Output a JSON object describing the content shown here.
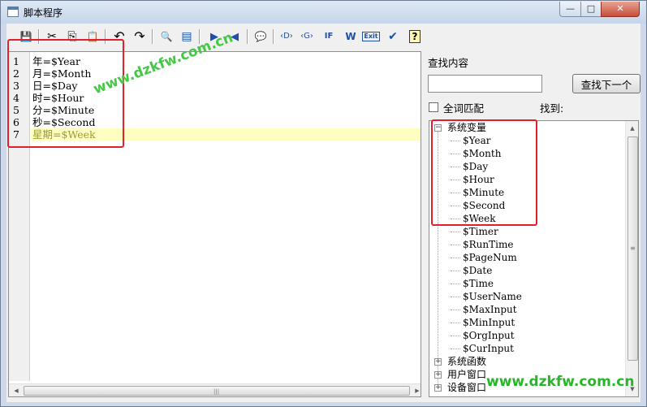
{
  "window": {
    "title": "脚本程序",
    "controls": {
      "minimize": "—",
      "maximize": "□",
      "close": "✕"
    }
  },
  "toolbar": {
    "icons": [
      {
        "name": "save-icon",
        "glyph": "💾"
      },
      {
        "name": "cut-icon",
        "glyph": "✂"
      },
      {
        "name": "copy-icon",
        "glyph": "⎘"
      },
      {
        "name": "paste-icon",
        "glyph": "📋"
      },
      {
        "name": "undo-icon",
        "glyph": "↶"
      },
      {
        "name": "redo-icon",
        "glyph": "↷"
      },
      {
        "name": "find-icon",
        "glyph": "🔍"
      },
      {
        "name": "replace-icon",
        "glyph": "▤"
      },
      {
        "name": "indent-icon",
        "glyph": "▶"
      },
      {
        "name": "outdent-icon",
        "glyph": "◀"
      },
      {
        "name": "comment-icon",
        "glyph": "💬"
      },
      {
        "name": "d-tag-icon",
        "glyph": "‹D›"
      },
      {
        "name": "g-tag-icon",
        "glyph": "‹G›"
      },
      {
        "name": "if-else-icon",
        "glyph": "IF"
      },
      {
        "name": "while-icon",
        "glyph": "W"
      },
      {
        "name": "exit-icon",
        "glyph": "Exit"
      },
      {
        "name": "check-icon",
        "glyph": "✔"
      },
      {
        "name": "help-icon",
        "glyph": "?"
      }
    ]
  },
  "editor": {
    "line_numbers": [
      "1",
      "2",
      "3",
      "4",
      "5",
      "6",
      "7"
    ],
    "lines": [
      "年=$Year",
      "月=$Month",
      "日=$Day",
      "时=$Hour",
      "分=$Minute",
      "秒=$Second",
      "星期=$Week"
    ],
    "current_line": 7
  },
  "find_panel": {
    "label": "查找内容",
    "input_value": "",
    "find_next_button": "查找下一个",
    "whole_word_label": "全词匹配",
    "whole_word_checked": false,
    "found_label": "找到:"
  },
  "tree": {
    "system_variables": {
      "label": "系统变量",
      "toggle": "−",
      "items": [
        "$Year",
        "$Month",
        "$Day",
        "$Hour",
        "$Minute",
        "$Second",
        "$Week",
        "$Timer",
        "$RunTime",
        "$PageNum",
        "$Date",
        "$Time",
        "$UserName",
        "$MaxInput",
        "$MinInput",
        "$OrgInput",
        "$CurInput"
      ]
    },
    "collapsed": [
      {
        "label": "系统函数",
        "toggle": "+"
      },
      {
        "label": "用户窗口",
        "toggle": "+"
      },
      {
        "label": "设备窗口",
        "toggle": "+"
      }
    ]
  },
  "watermark": "www.dzkfw.com.cn",
  "colors": {
    "highlight_box": "#e0212b",
    "watermark": "#2fbf2f",
    "current_line_bg": "#fefec0"
  }
}
